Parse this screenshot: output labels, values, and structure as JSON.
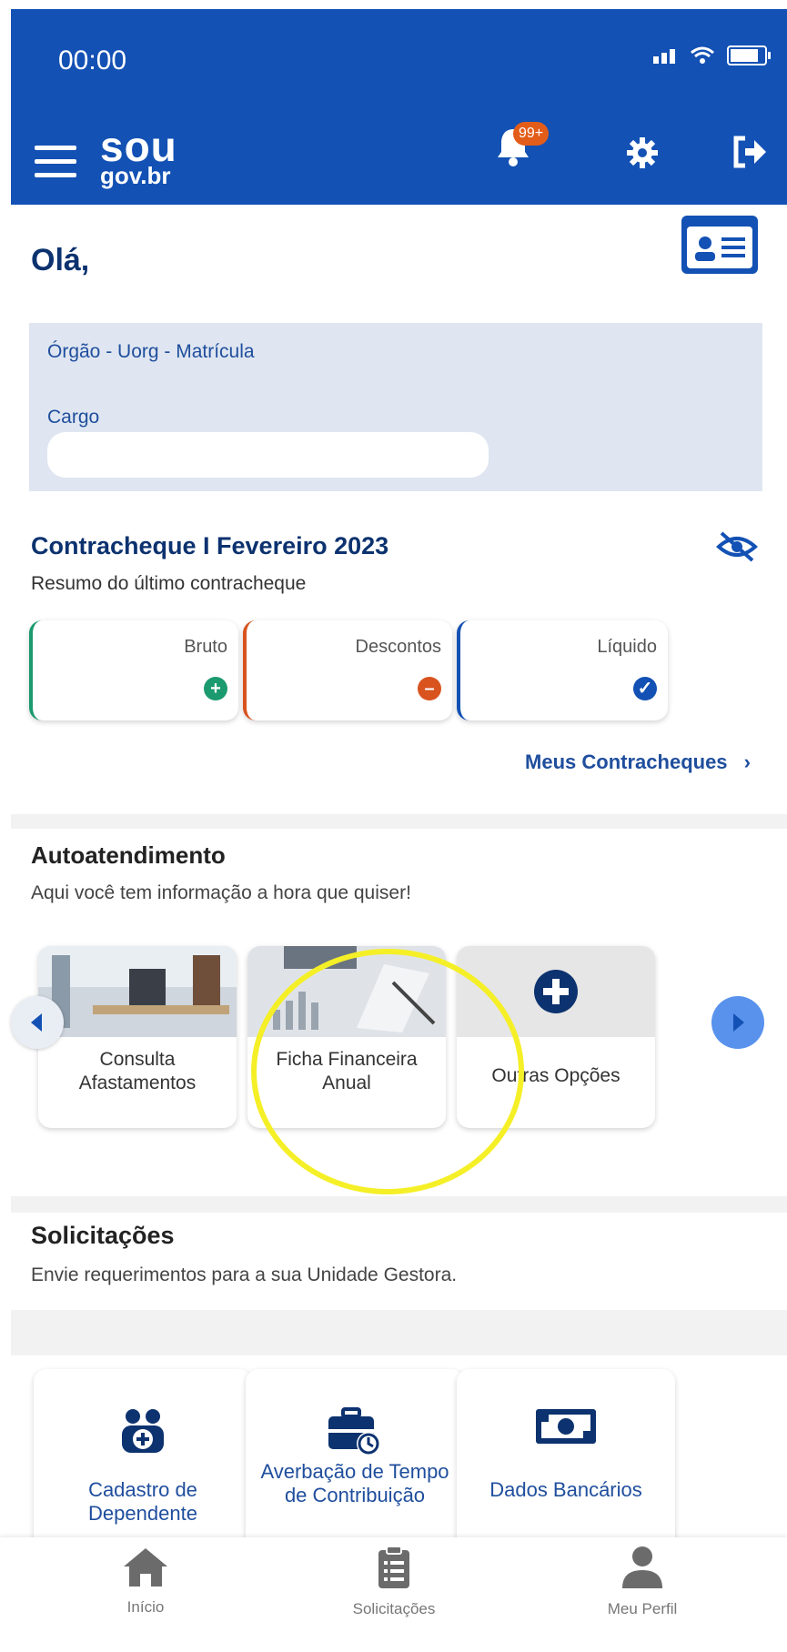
{
  "status_bar": {
    "time": "00:00"
  },
  "header": {
    "logo_top": "sou",
    "logo_bottom": "gov.br",
    "notification_badge": "99+",
    "brand_color": "#1351b4"
  },
  "greeting": {
    "text": "Olá,"
  },
  "info": {
    "org_label": "Órgão - Uorg - Matrícula",
    "role_label": "Cargo"
  },
  "payslip": {
    "title": "Contracheque I Fevereiro 2023",
    "subtitle": "Resumo do último contracheque",
    "cards": [
      {
        "label": "Bruto",
        "icon": "plus-circle-icon",
        "color": "#1a9a6e"
      },
      {
        "label": "Descontos",
        "icon": "minus-circle-icon",
        "color": "#d9531e"
      },
      {
        "label": "Líquido",
        "icon": "check-circle-icon",
        "color": "#1351b4"
      }
    ],
    "link": "Meus Contracheques"
  },
  "self_service": {
    "title": "Autoatendimento",
    "subtitle": "Aqui você tem informação a hora que quiser!",
    "items": [
      {
        "label": "Consulta Afastamentos"
      },
      {
        "label": "Ficha Financeira Anual"
      },
      {
        "label": "Outras Opções"
      }
    ]
  },
  "requests": {
    "title": "Solicitações",
    "subtitle": "Envie requerimentos para a sua Unidade Gestora.",
    "items": [
      {
        "label": "Cadastro de Dependente",
        "icon": "dependents-icon"
      },
      {
        "label": "Averbação de Tempo de Contribuição",
        "icon": "briefcase-clock-icon"
      },
      {
        "label": "Dados Bancários",
        "icon": "banknote-icon"
      }
    ]
  },
  "tabbar": {
    "items": [
      {
        "label": "Início",
        "icon": "home-icon"
      },
      {
        "label": "Solicitações",
        "icon": "clipboard-icon"
      },
      {
        "label": "Meu Perfil",
        "icon": "profile-icon"
      }
    ]
  }
}
